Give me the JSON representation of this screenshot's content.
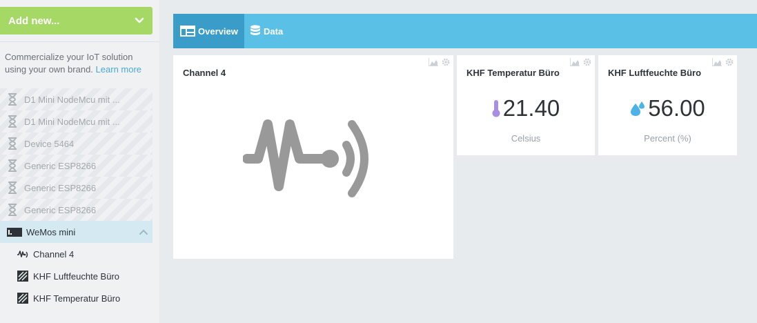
{
  "sidebar": {
    "add_new_label": "Add new...",
    "promo_text": "Commercialize your IoT solution using your own brand.",
    "promo_link": "Learn more",
    "devices": [
      {
        "label": "D1 Mini NodeMcu mit ..."
      },
      {
        "label": "D1 Mini NodeMcu mit ..."
      },
      {
        "label": "Device 5464"
      },
      {
        "label": "Generic ESP8266"
      },
      {
        "label": "Generic ESP8266"
      },
      {
        "label": "Generic ESP8266"
      }
    ],
    "active_device": {
      "label": "WeMos mini"
    },
    "sub_items": [
      {
        "label": "Channel 4",
        "icon": "signal-icon"
      },
      {
        "label": "KHF Luftfeuchte Büro",
        "icon": "sensor-icon"
      },
      {
        "label": "KHF Temperatur Büro",
        "icon": "sensor-icon"
      }
    ]
  },
  "tabs": {
    "overview": "Overview",
    "data": "Data"
  },
  "widgets": {
    "channel": {
      "title": "Channel 4"
    },
    "temperature": {
      "title": "KHF Temperatur Büro",
      "value": "21.40",
      "unit": "Celsius"
    },
    "humidity": {
      "title": "KHF Luftfeuchte Büro",
      "value": "56.00",
      "unit": "Percent (%)"
    }
  },
  "colors": {
    "add_new": "#a6d866",
    "tabbar": "#5bc0e5",
    "tab_active": "#3a9dc9",
    "thermometer": "#a98fe0",
    "droplet": "#4db3e6"
  }
}
